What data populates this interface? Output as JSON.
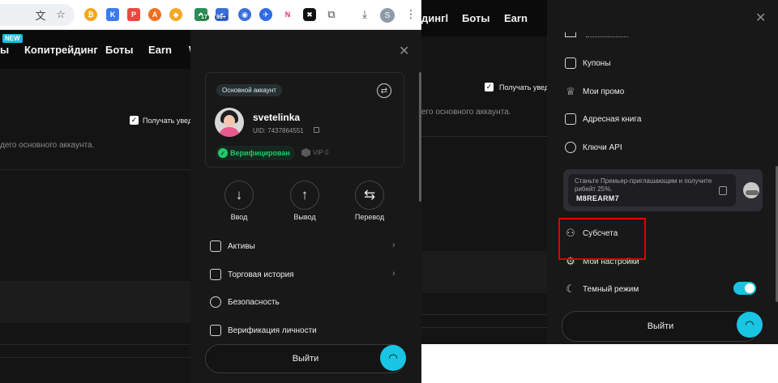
{
  "left": {
    "browser": {
      "icons": [
        "translate-icon",
        "star-icon",
        "extensions-puzzle-icon",
        "download-icon",
        "kebab-menu-icon"
      ],
      "extensions": [
        {
          "name": "ext-orange-icon",
          "glyph": "₿",
          "color": "#f2a71b"
        },
        {
          "name": "ext-k-icon",
          "glyph": "K",
          "color": "#3d7bf2"
        },
        {
          "name": "ext-red-icon",
          "glyph": "P",
          "color": "#e9483f"
        },
        {
          "name": "ext-fire-icon",
          "glyph": "A",
          "color": "#f06f21"
        },
        {
          "name": "ext-fox-icon",
          "glyph": "🦊",
          "color": "#ffffff"
        },
        {
          "name": "ext-green-icon",
          "glyph": "◆",
          "color": "#2e8b57"
        },
        {
          "name": "ext-blue-icon",
          "glyph": "●",
          "color": "#3b6fd8"
        },
        {
          "name": "ext-bird-icon",
          "glyph": "✈",
          "color": "#2f6be4"
        },
        {
          "name": "ext-n-icon",
          "glyph": "N",
          "color": "#ffffff"
        },
        {
          "name": "ext-square-icon",
          "glyph": "✖",
          "color": "#111111"
        }
      ],
      "badges": {
        "green": "17",
        "blue": "99+"
      },
      "profile_initial": "S"
    },
    "nav": {
      "new_badge": "NEW",
      "items": [
        "ы",
        "Копитрейдинг",
        "Боты",
        "Earn",
        "W"
      ]
    },
    "page": {
      "checkbox_label": "Получать увед",
      "description": "дего основного аккаунта."
    },
    "drawer": {
      "account_chip": "Основной аккаунт",
      "username": "svetelinka",
      "uid": "UID: 7437864551",
      "verified": "Верифицирован",
      "vip": "VIP 0",
      "actions": [
        {
          "label": "Ввод",
          "icon": "arrow-down-icon",
          "glyph": "↓"
        },
        {
          "label": "Вывод",
          "icon": "arrow-up-icon",
          "glyph": "↑"
        },
        {
          "label": "Перевод",
          "icon": "transfer-icon",
          "glyph": "⇆"
        }
      ],
      "menu": [
        {
          "label": "Активы",
          "icon": "wallet-icon",
          "glyph": "▭"
        },
        {
          "label": "Торговая история",
          "icon": "history-icon",
          "glyph": "≡"
        },
        {
          "label": "Безопасность",
          "icon": "shield-icon",
          "glyph": "✓"
        },
        {
          "label": "Верификация личности",
          "icon": "id-card-icon",
          "glyph": "☰"
        }
      ],
      "logout": "Выйти"
    }
  },
  "right": {
    "nav": {
      "items": [
        "дингl",
        "Боты",
        "Earn"
      ]
    },
    "page": {
      "checkbox_label": "Получать уведо",
      "description": "его основного аккаунта."
    },
    "drawer": {
      "menu_top": [
        {
          "label": "Купоны",
          "icon": "ticket-icon",
          "glyph": "▭"
        },
        {
          "label": "Мои промо",
          "icon": "trophy-icon",
          "glyph": "♕"
        },
        {
          "label": "Адресная книга",
          "icon": "address-book-icon",
          "glyph": "☷"
        },
        {
          "label": "Ключи API",
          "icon": "api-key-icon",
          "glyph": "⌘"
        }
      ],
      "promo": {
        "text": "Станьте Премьер-приглашающим и получите рибейт 25%.",
        "code": "M8REARM7"
      },
      "menu_bottom": [
        {
          "label": "Субсчета",
          "icon": "subaccounts-icon",
          "glyph": "⚇"
        },
        {
          "label": "Мои настройки",
          "icon": "settings-icon",
          "glyph": "⚙"
        },
        {
          "label": "Темный режим",
          "icon": "moon-icon",
          "glyph": "☾"
        }
      ],
      "dark_mode_enabled": true,
      "logout": "Выйти"
    }
  },
  "colors": {
    "accent": "#18c5e2",
    "verified": "#23c96a",
    "highlight": "#e00000"
  }
}
